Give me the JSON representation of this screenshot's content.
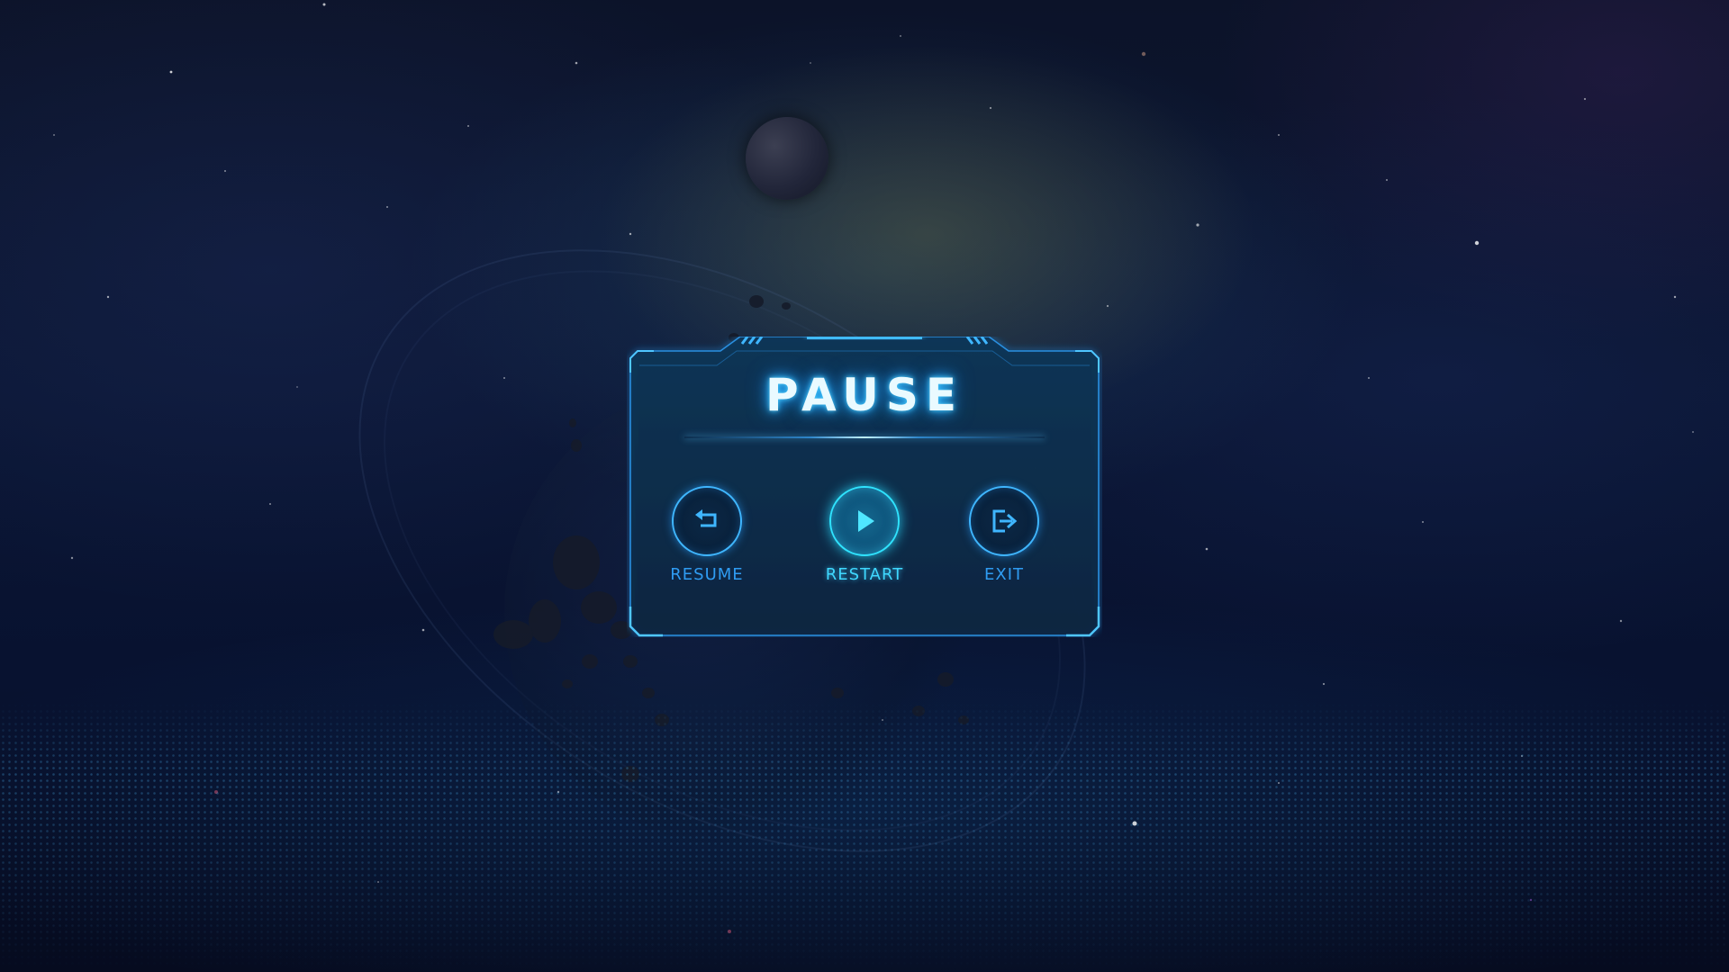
{
  "pause_menu": {
    "title": "PAUSE",
    "buttons": [
      {
        "id": "resume",
        "label": "RESUME",
        "icon": "resume-arrow-icon",
        "selected": false
      },
      {
        "id": "restart",
        "label": "RESTART",
        "icon": "play-icon",
        "selected": true
      },
      {
        "id": "exit",
        "label": "EXIT",
        "icon": "exit-door-icon",
        "selected": false
      }
    ]
  },
  "colors": {
    "accent": "#3fb6ff",
    "accent_active": "#2fe3ff",
    "panel_bg": "#0b2a4a",
    "title_glow": "#4fd2ff",
    "background": "#0b1634"
  }
}
